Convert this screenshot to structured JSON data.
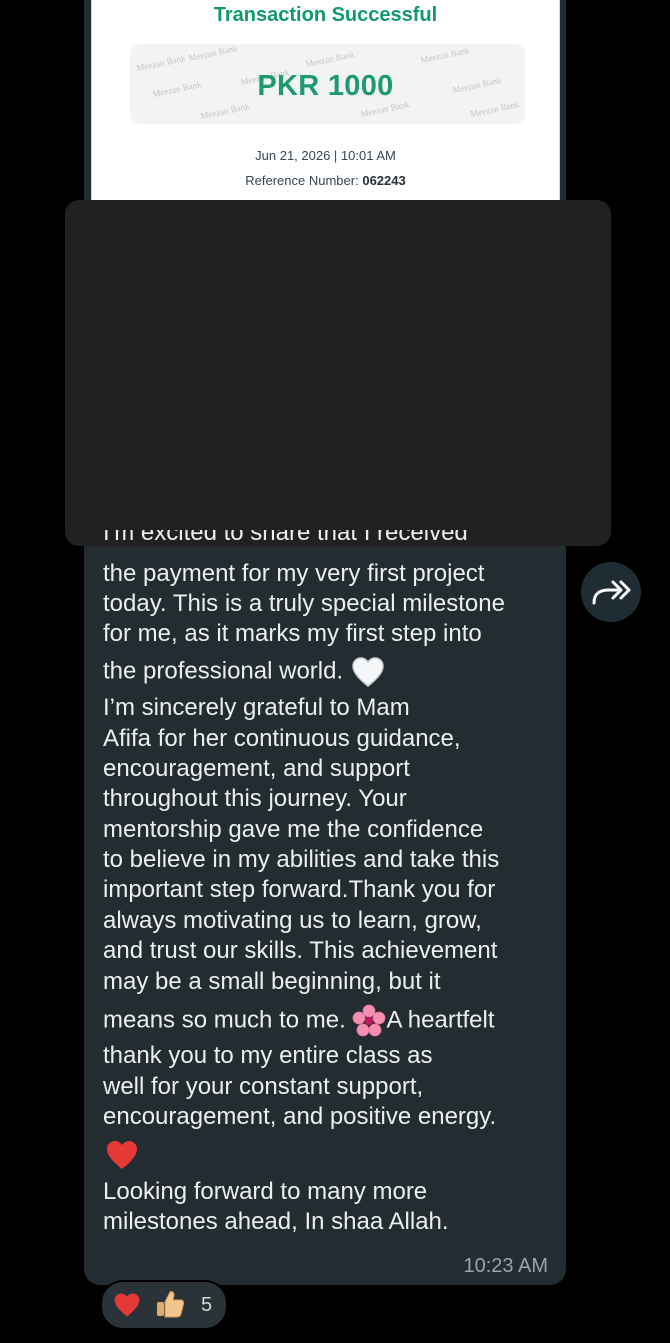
{
  "receipt": {
    "title": "Transaction Successful",
    "amount": "PKR 1000",
    "watermark": "Meezan Bank",
    "date_time": "Jun 21, 2026 | 10:01 AM",
    "reference_label": "Reference Number:",
    "reference_value": "062243"
  },
  "message": {
    "cut_line": "I'm excited to share that I received",
    "lines": [
      "the payment for my very first project",
      "today. This is a truly special milestone",
      "for me, as it marks my first step into",
      "the professional world.",
      "I’m sincerely grateful to Mam",
      "Afifa for her continuous guidance,",
      "encouragement, and support",
      "throughout this journey. Your",
      "mentorship gave me the confidence",
      "to believe in my abilities and take this",
      "important step forward.Thank you for",
      "always motivating us to learn, grow,",
      "and trust our skills. This achievement",
      "may be a small beginning, but it",
      "means so much to me.",
      "A heartfelt",
      "thank you to my entire class as",
      "well for your constant support,",
      "encouragement, and positive energy.",
      "Looking forward to many more",
      "milestones ahead, In shaa Allah."
    ],
    "emojis": {
      "white_heart": "white-heart-icon",
      "cherry_blossom": "cherry-blossom-icon",
      "red_heart": "red-heart-icon"
    },
    "time": "10:23 AM"
  },
  "reactions": {
    "icons": [
      "red-heart-icon",
      "thumbs-up-icon"
    ],
    "count": "5"
  },
  "colors": {
    "background": "#000000",
    "bubble": "#222c31",
    "success_green": "#0f9a6c",
    "text": "#eceff1",
    "meta_text": "#9aa4a9"
  }
}
